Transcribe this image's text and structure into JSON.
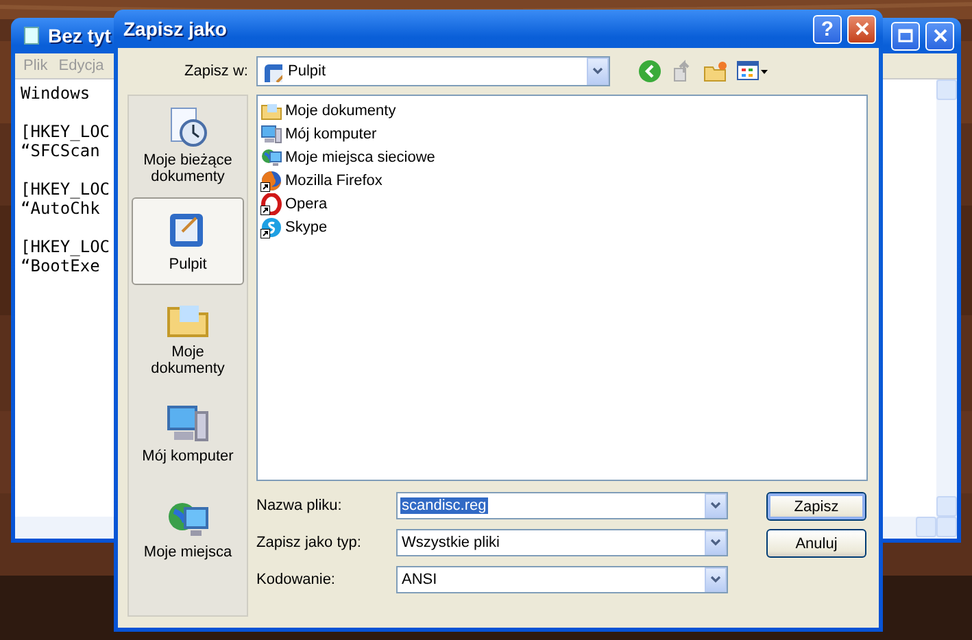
{
  "background_window": {
    "title": "Bez tyt",
    "menu": [
      "Plik",
      "Edycja"
    ],
    "paragraphs": [
      [
        "Windows"
      ],
      [
        "[HKEY_LOC",
        "“SFCScan"
      ],
      [
        "[HKEY_LOC",
        "“AutoChk"
      ],
      [
        "[HKEY_LOC",
        "“BootExe"
      ]
    ]
  },
  "dialog": {
    "title": "Zapisz jako",
    "help_button": "?",
    "save_in": {
      "label": "Zapisz w:",
      "value": "Pulpit"
    },
    "places": [
      {
        "label": "Moje bieżące dokumenty",
        "kind": "recent",
        "selected": false
      },
      {
        "label": "Pulpit",
        "kind": "desktop",
        "selected": true
      },
      {
        "label": "Moje dokumenty",
        "kind": "documents",
        "selected": false
      },
      {
        "label": "Mój komputer",
        "kind": "computer",
        "selected": false
      },
      {
        "label": "Moje miejsca",
        "kind": "network",
        "selected": false
      }
    ],
    "files": [
      {
        "name": "Moje dokumenty",
        "kind": "documents",
        "shortcut": false
      },
      {
        "name": "Mój komputer",
        "kind": "computer",
        "shortcut": false
      },
      {
        "name": "Moje miejsca sieciowe",
        "kind": "network",
        "shortcut": false
      },
      {
        "name": "Mozilla Firefox",
        "kind": "firefox",
        "shortcut": true
      },
      {
        "name": "Opera",
        "kind": "opera",
        "shortcut": true
      },
      {
        "name": "Skype",
        "kind": "skype",
        "shortcut": true
      }
    ],
    "fields": [
      {
        "label": "Nazwa pliku:",
        "value": "scandisc.reg",
        "text_selected": true
      },
      {
        "label": "Zapisz jako typ:",
        "value": "Wszystkie pliki",
        "text_selected": false
      },
      {
        "label": "Kodowanie:",
        "value": "ANSI",
        "text_selected": false
      }
    ],
    "buttons": [
      {
        "label": "Zapisz",
        "default": true
      },
      {
        "label": "Anuluj",
        "default": false
      }
    ]
  }
}
